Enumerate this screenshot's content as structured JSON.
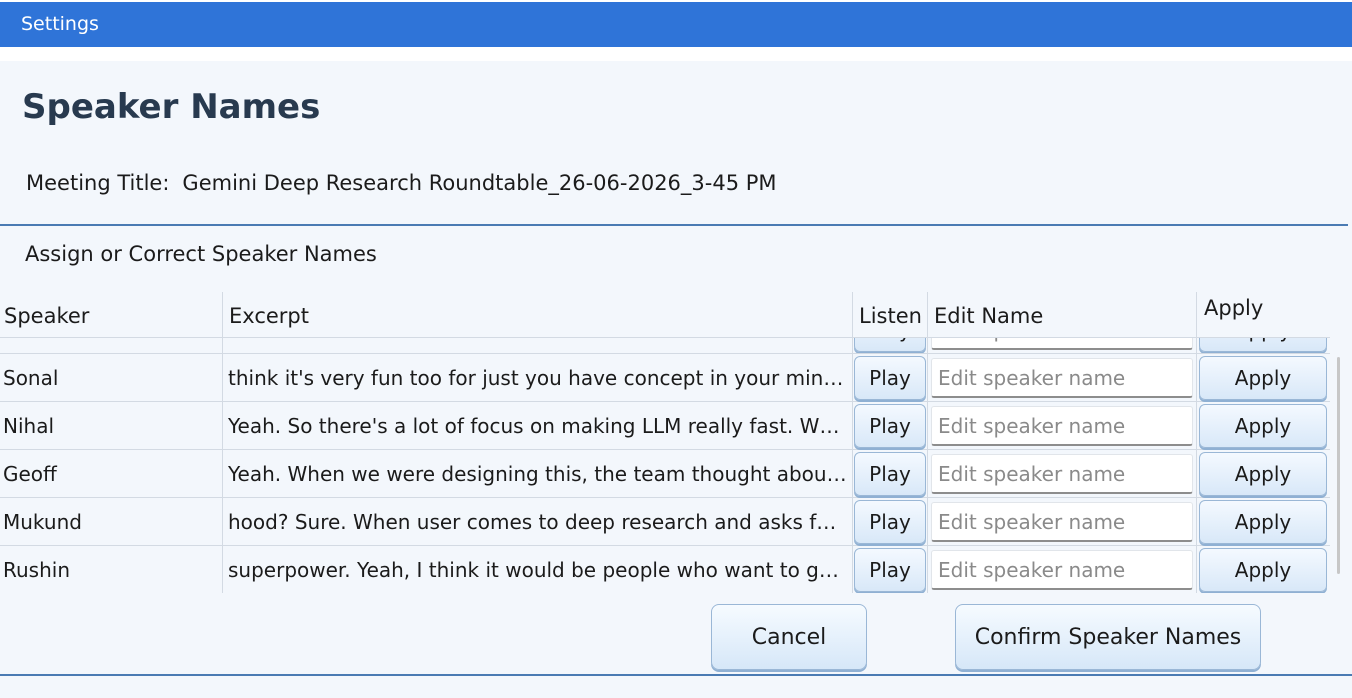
{
  "window": {
    "title": "Settings"
  },
  "page": {
    "title": "Speaker Names",
    "meeting_label": "Meeting Title:",
    "meeting_title": "Gemini Deep Research Roundtable_26-06-2026_3-45 PM",
    "subtitle": "Assign or Correct Speaker Names"
  },
  "table": {
    "columns": [
      "Speaker",
      "Excerpt",
      "Listen",
      "Edit Name",
      "Apply"
    ],
    "play_label": "Play",
    "apply_label": "Apply",
    "edit_placeholder": "Edit speaker name",
    "rows": [
      {
        "speaker": "Sonal",
        "excerpt": "think it's very fun too for just you have concept in your mind..."
      },
      {
        "speaker": "Nihal",
        "excerpt": "Yeah. So there's a lot of focus on making LLM really fast. Wh..."
      },
      {
        "speaker": "Geoff",
        "excerpt": "Yeah. When we were designing this, the team thought about..."
      },
      {
        "speaker": "Mukund",
        "excerpt": "hood? Sure. When user comes to deep research and asks for..."
      },
      {
        "speaker": "Rushin",
        "excerpt": "superpower. Yeah, I think it would be people who want to ge..."
      }
    ]
  },
  "footer": {
    "cancel_label": "Cancel",
    "confirm_label": "Confirm Speaker Names"
  },
  "colors": {
    "titlebar": "#2f74d8",
    "background": "#f3f7fc",
    "separator": "#4a7bb3",
    "button_border": "#9ab7d6"
  }
}
